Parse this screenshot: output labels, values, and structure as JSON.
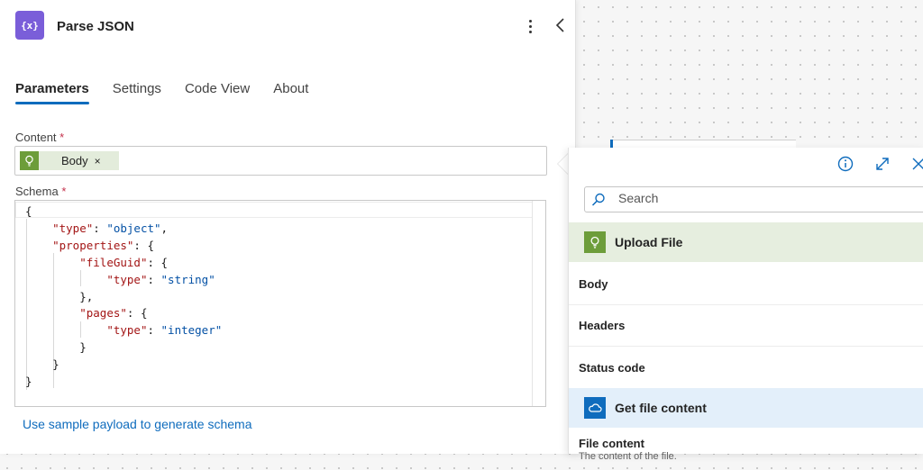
{
  "header": {
    "icon_text": "{x}",
    "title": "Parse JSON"
  },
  "tabs": [
    {
      "label": "Parameters",
      "active": true
    },
    {
      "label": "Settings"
    },
    {
      "label": "Code View"
    },
    {
      "label": "About"
    }
  ],
  "content_field": {
    "label": "Content",
    "required_mark": "*",
    "token": {
      "label": "Body",
      "remove": "×"
    }
  },
  "schema_field": {
    "label": "Schema",
    "required_mark": "*",
    "code_lines": [
      "{",
      "    \"type\": \"object\",",
      "    \"properties\": {",
      "        \"fileGuid\": {",
      "            \"type\": \"string\"",
      "        },",
      "        \"pages\": {",
      "            \"type\": \"integer\"",
      "        }",
      "    }",
      "}"
    ]
  },
  "sample_link": "Use sample payload to generate schema",
  "dynamic_content": {
    "search_placeholder": "Search",
    "sections": [
      {
        "title": "Upload File",
        "icon": "spreadsheet-bulb-icon",
        "color": "#e6eedf",
        "icon_color": "#6d9d3a",
        "items": [
          {
            "label": "Body"
          },
          {
            "label": "Headers"
          },
          {
            "label": "Status code"
          }
        ]
      },
      {
        "title": "Get file content",
        "icon": "onedrive-cloud-icon",
        "color": "#e3effa",
        "icon_color": "#0f6cbd",
        "items": [
          {
            "label": "File content",
            "desc": "The content of the file."
          }
        ]
      }
    ]
  },
  "colors": {
    "accent": "#0f6cbd",
    "action_icon": "#7a5ed9",
    "required": "#c4314b"
  }
}
